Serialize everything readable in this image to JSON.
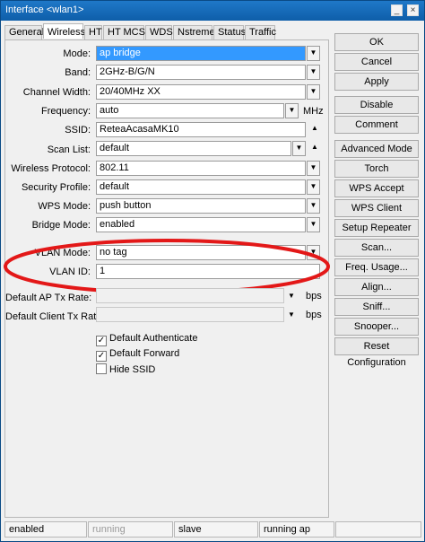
{
  "window": {
    "title": "Interface <wlan1>",
    "minimize": "_",
    "close": "×"
  },
  "tabs": [
    "General",
    "Wireless",
    "HT",
    "HT MCS",
    "WDS",
    "Nstreme",
    "Status",
    "Traffic"
  ],
  "form": {
    "mode_label": "Mode:",
    "mode_value": "ap bridge",
    "band_label": "Band:",
    "band_value": "2GHz-B/G/N",
    "channel_width_label": "Channel Width:",
    "channel_width_value": "20/40MHz XX",
    "frequency_label": "Frequency:",
    "frequency_value": "auto",
    "frequency_unit": "MHz",
    "ssid_label": "SSID:",
    "ssid_value": "ReteaAcasaMK10",
    "scan_list_label": "Scan List:",
    "scan_list_value": "default",
    "wireless_protocol_label": "Wireless Protocol:",
    "wireless_protocol_value": "802.11",
    "security_profile_label": "Security Profile:",
    "security_profile_value": "default",
    "wps_mode_label": "WPS Mode:",
    "wps_mode_value": "push button",
    "bridge_mode_label": "Bridge Mode:",
    "bridge_mode_value": "enabled",
    "vlan_mode_label": "VLAN Mode:",
    "vlan_mode_value": "no tag",
    "vlan_id_label": "VLAN ID:",
    "vlan_id_value": "1",
    "ap_tx_rate_label": "Default AP Tx Rate:",
    "ap_tx_rate_value": "",
    "client_tx_rate_label": "Default Client Tx Rate:",
    "client_tx_rate_value": "",
    "bps_unit": "bps",
    "default_authenticate_label": "Default Authenticate",
    "default_forward_label": "Default Forward",
    "hide_ssid_label": "Hide SSID"
  },
  "checkboxes": {
    "default_authenticate": true,
    "default_forward": true,
    "hide_ssid": false
  },
  "buttons": [
    "OK",
    "Cancel",
    "Apply",
    "Disable",
    "Comment",
    "Advanced Mode",
    "Torch",
    "WPS Accept",
    "WPS Client",
    "Setup Repeater",
    "Scan...",
    "Freq. Usage...",
    "Align...",
    "Sniff...",
    "Snooper...",
    "Reset Configuration"
  ],
  "status": [
    "enabled",
    "running",
    "slave",
    "running ap",
    ""
  ],
  "icons": {
    "dropdown": "▼",
    "up": "▲",
    "check": "✓"
  },
  "colors": {
    "title_bar": "#1f78c8",
    "selection": "#3399ff",
    "callout_red": "#e31818"
  }
}
